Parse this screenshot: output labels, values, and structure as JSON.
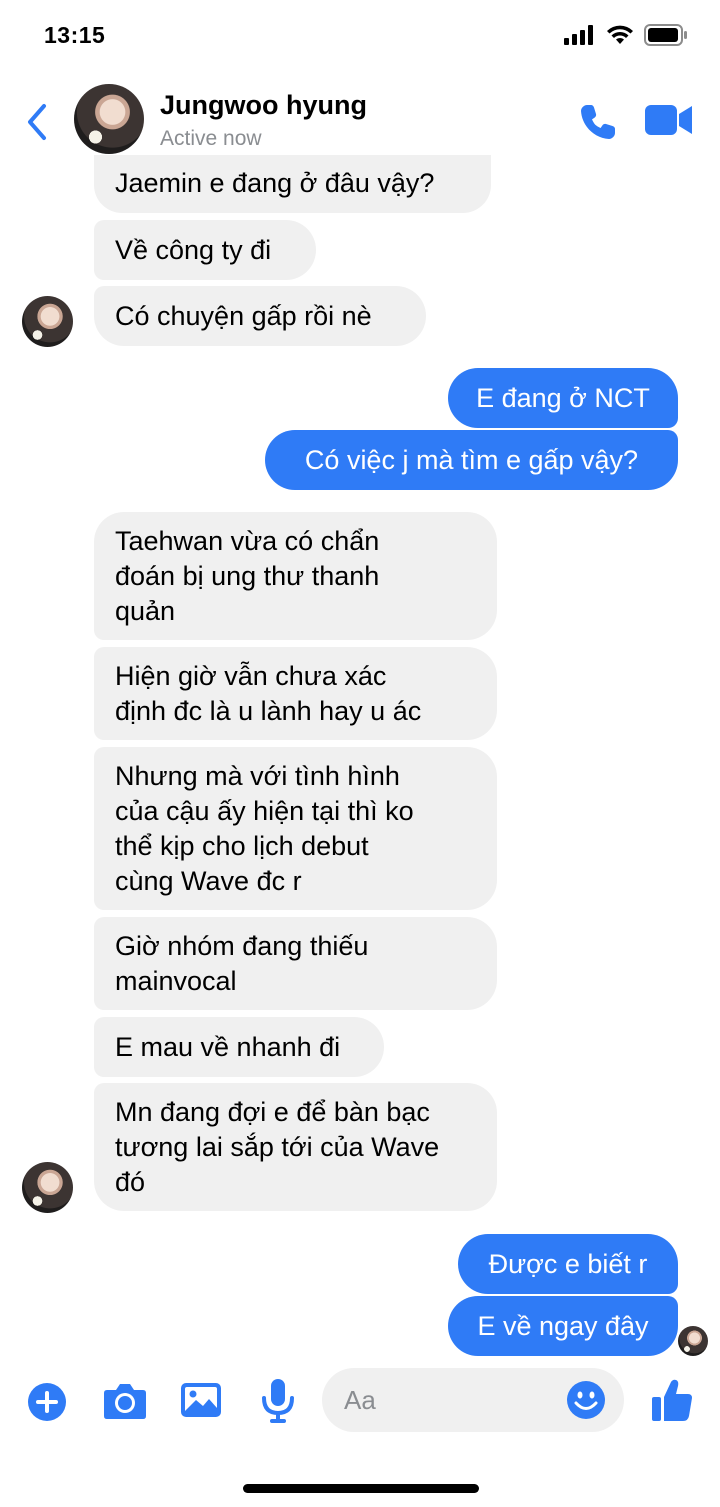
{
  "status_bar": {
    "time": "13:15"
  },
  "header": {
    "contact_name": "Jungwoo hyung",
    "contact_status": "Active now"
  },
  "messages": [
    {
      "sender": "them",
      "text": "Jaemin e đang ở đâu vậy?"
    },
    {
      "sender": "them",
      "text": "Về công ty đi"
    },
    {
      "sender": "them",
      "text": "Có chuyện gấp rồi nè"
    },
    {
      "sender": "me",
      "text": "E đang ở NCT"
    },
    {
      "sender": "me",
      "text": "Có việc j mà tìm e gấp vậy?"
    },
    {
      "sender": "them",
      "text": "Taehwan vừa có chẩn\nđoán bị ung thư thanh\nquản"
    },
    {
      "sender": "them",
      "text": "Hiện giờ vẫn chưa xác\nđịnh đc là u lành hay u ác"
    },
    {
      "sender": "them",
      "text": "Nhưng mà với tình hình\ncủa cậu ấy hiện tại thì ko\nthể kịp cho lịch debut\ncùng Wave đc r"
    },
    {
      "sender": "them",
      "text": "Giờ nhóm đang thiếu\nmainvocal"
    },
    {
      "sender": "them",
      "text": "E mau về nhanh đi"
    },
    {
      "sender": "them",
      "text": "Mn đang đợi e để bàn bạc\ntương lai sắp tới của Wave\nđó"
    },
    {
      "sender": "me",
      "text": "Được e biết r"
    },
    {
      "sender": "me",
      "text": "E về ngay đây"
    }
  ],
  "composer": {
    "placeholder": "Aa"
  },
  "colors": {
    "accent": "#2f7bf6",
    "incoming_bubble": "#f0f0f0",
    "muted_text": "#8a8d91"
  },
  "icons": [
    "back-chevron-icon",
    "phone-icon",
    "video-camera-icon",
    "plus-icon",
    "camera-icon",
    "image-icon",
    "microphone-icon",
    "emoji-icon",
    "thumbs-up-icon"
  ]
}
